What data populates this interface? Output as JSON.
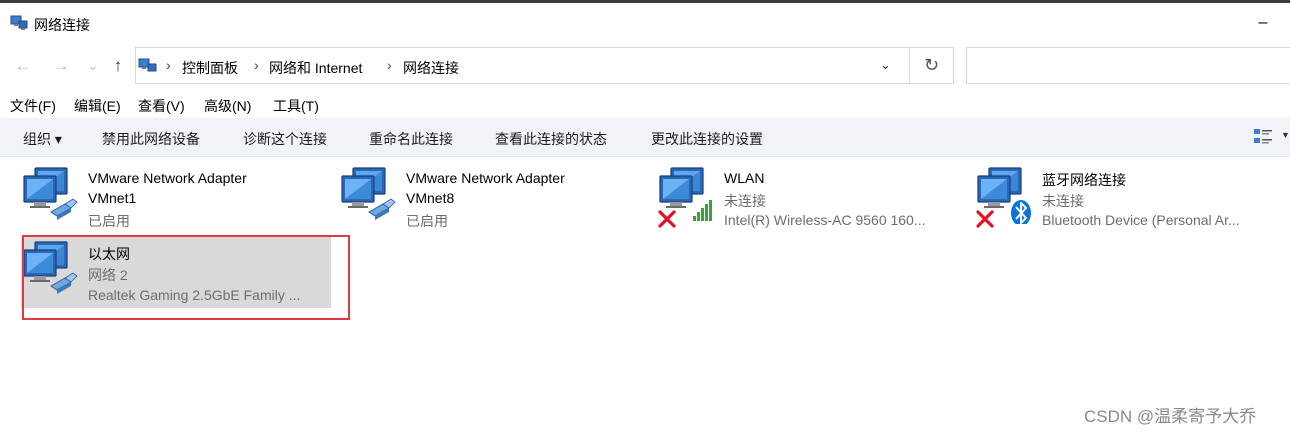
{
  "window": {
    "title": "网络连接",
    "minimize_glyph": "–"
  },
  "nav": {
    "back_icon": "←",
    "forward_icon": "→",
    "recent_icon": "⌄",
    "up_icon": "↑",
    "refresh_icon": "↻",
    "dropdown_icon": "⌄"
  },
  "breadcrumb": {
    "separator": "›",
    "items": [
      "控制面板",
      "网络和 Internet",
      "网络连接"
    ]
  },
  "search": {
    "placeholder": ""
  },
  "menu": [
    "文件(F)",
    "编辑(E)",
    "查看(V)",
    "高级(N)",
    "工具(T)"
  ],
  "commands": [
    "组织 ▾",
    "禁用此网络设备",
    "诊断这个连接",
    "重命名此连接",
    "查看此连接的状态",
    "更改此连接的设置"
  ],
  "connections": [
    {
      "name": "VMware Network Adapter",
      "name2": "VMnet1",
      "status": "已启用",
      "device": "",
      "badge": "none",
      "icon": "ethernet-icon"
    },
    {
      "name": "VMware Network Adapter",
      "name2": "VMnet8",
      "status": "已启用",
      "device": "",
      "badge": "none",
      "icon": "ethernet-icon"
    },
    {
      "name": "WLAN",
      "name2": "",
      "status": "未连接",
      "device": "Intel(R) Wireless-AC 9560 160...",
      "badge": "disconnected",
      "icon": "wifi-signal-icon"
    },
    {
      "name": "蓝牙网络连接",
      "name2": "",
      "status": "未连接",
      "device": "Bluetooth Device (Personal Ar...",
      "badge": "disconnected",
      "icon": "bluetooth-icon"
    },
    {
      "name": "以太网",
      "name2": "",
      "status": "网络 2",
      "device": "Realtek Gaming 2.5GbE Family ...",
      "badge": "none",
      "icon": "ethernet-icon",
      "selected": true
    }
  ],
  "watermark": "CSDN @温柔寄予大乔",
  "colors": {
    "highlight_frame": "#e0393e",
    "selection": "#d9d9d9",
    "command_bar": "#f0f4f9",
    "bluetooth": "#0a74d9",
    "wifi": "#3aa33a",
    "error": "#e81123"
  }
}
